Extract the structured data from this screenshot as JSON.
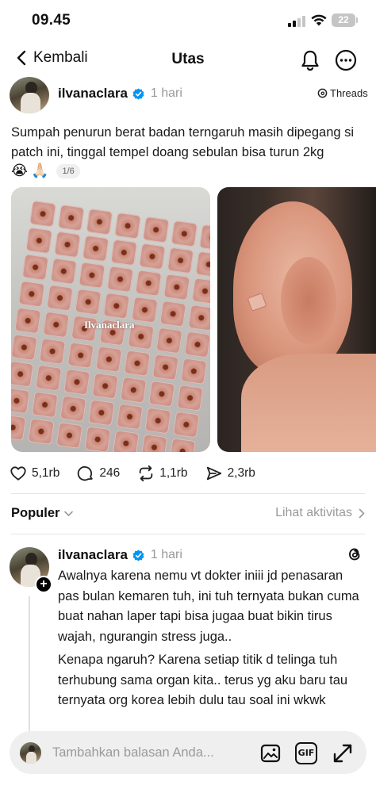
{
  "status_bar": {
    "time": "09.45",
    "battery": "22"
  },
  "header": {
    "back_label": "Kembali",
    "title": "Utas"
  },
  "post": {
    "username": "ilvanaclara",
    "time": "1 hari",
    "source_label": "Threads",
    "text": "Sumpah penurun berat badan terngaruh masih dipegang si patch ini, tinggal tempel doang sebulan bisa turun 2kg",
    "emojis": [
      "😭",
      "🙏🏻"
    ],
    "page_indicator": "1/6",
    "image_watermark": "Ilvanaclara",
    "likes": "5,1rb",
    "comments": "246",
    "reposts": "1,1rb",
    "shares": "2,3rb"
  },
  "sort": {
    "label": "Populer",
    "activity_link": "Lihat aktivitas"
  },
  "reply": {
    "username": "ilvanaclara",
    "time": "1 hari",
    "paragraph1": "Awalnya karena nemu vt dokter iniii jd penasaran pas bulan kemaren tuh, ini tuh ternyata bukan cuma buat nahan laper tapi bisa jugaa buat bikin tirus wajah, ngurangin stress juga..",
    "paragraph2": "Kenapa ngaruh? Karena setiap titik d telinga tuh terhubung sama organ kita.. terus yg aku baru tau ternyata org korea lebih dulu tau soal ini wkwk"
  },
  "composer": {
    "placeholder": "Tambahkan balasan Anda...",
    "gif_label": "GIF"
  },
  "icons": {
    "back": "chevron-left-icon",
    "bell": "bell-icon",
    "more": "more-icon",
    "verified": "verified-badge-icon",
    "like": "heart-icon",
    "comment": "comment-icon",
    "repost": "repost-icon",
    "share": "send-icon",
    "image": "image-icon",
    "gif": "gif-icon",
    "expand": "expand-icon"
  },
  "colors": {
    "verified_blue": "#0095f6",
    "muted_text": "#9a9a9a",
    "composer_bg": "#efefef"
  }
}
